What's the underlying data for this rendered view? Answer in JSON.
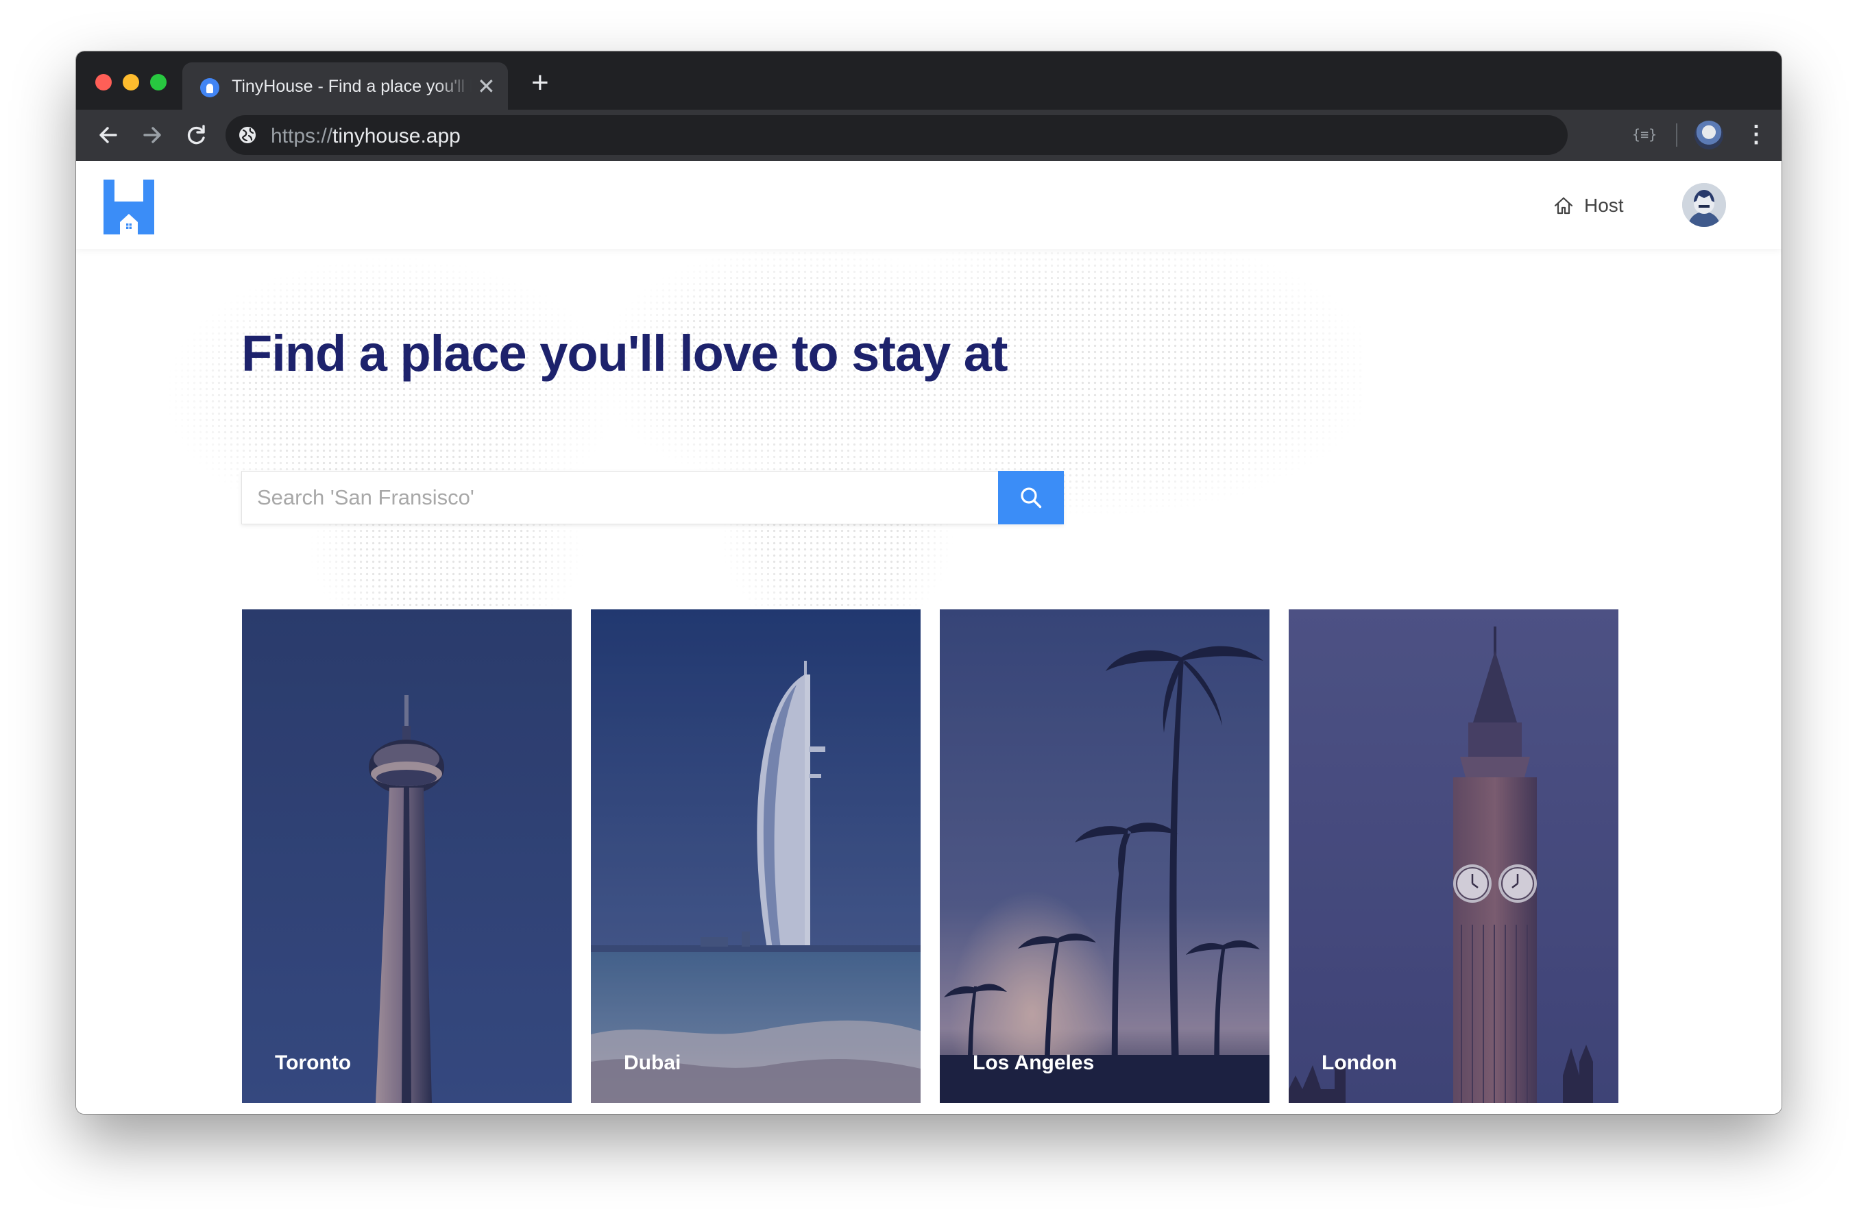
{
  "browser": {
    "tab_title": "TinyHouse - Find a place you'll love to stay at",
    "close_glyph": "✕",
    "new_tab_glyph": "+",
    "url_scheme": "https://",
    "url_host": "tinyhouse.app",
    "extension_label": "{≡}",
    "menu_glyph": "⋮",
    "icons": [
      "back-arrow-icon",
      "forward-arrow-icon",
      "reload-icon",
      "globe-icon",
      "profile-icon",
      "kebab-menu-icon"
    ]
  },
  "app": {
    "brand_color": "#3b8df7",
    "title_color": "#1d226c",
    "logo": "tinyhouse-logo-icon",
    "nav": {
      "host_label": "Host",
      "host_icon": "home-icon",
      "avatar": "user-avatar"
    }
  },
  "hero": {
    "title": "Find a place you'll love to stay at",
    "search": {
      "placeholder": "Search 'San Fransisco'",
      "value": "",
      "button_icon": "search-icon"
    }
  },
  "cities": [
    {
      "label": "Toronto",
      "image": "cn-tower-photo"
    },
    {
      "label": "Dubai",
      "image": "burj-al-arab-photo"
    },
    {
      "label": "Los Angeles",
      "image": "palm-trees-photo"
    },
    {
      "label": "London",
      "image": "big-ben-photo"
    }
  ]
}
